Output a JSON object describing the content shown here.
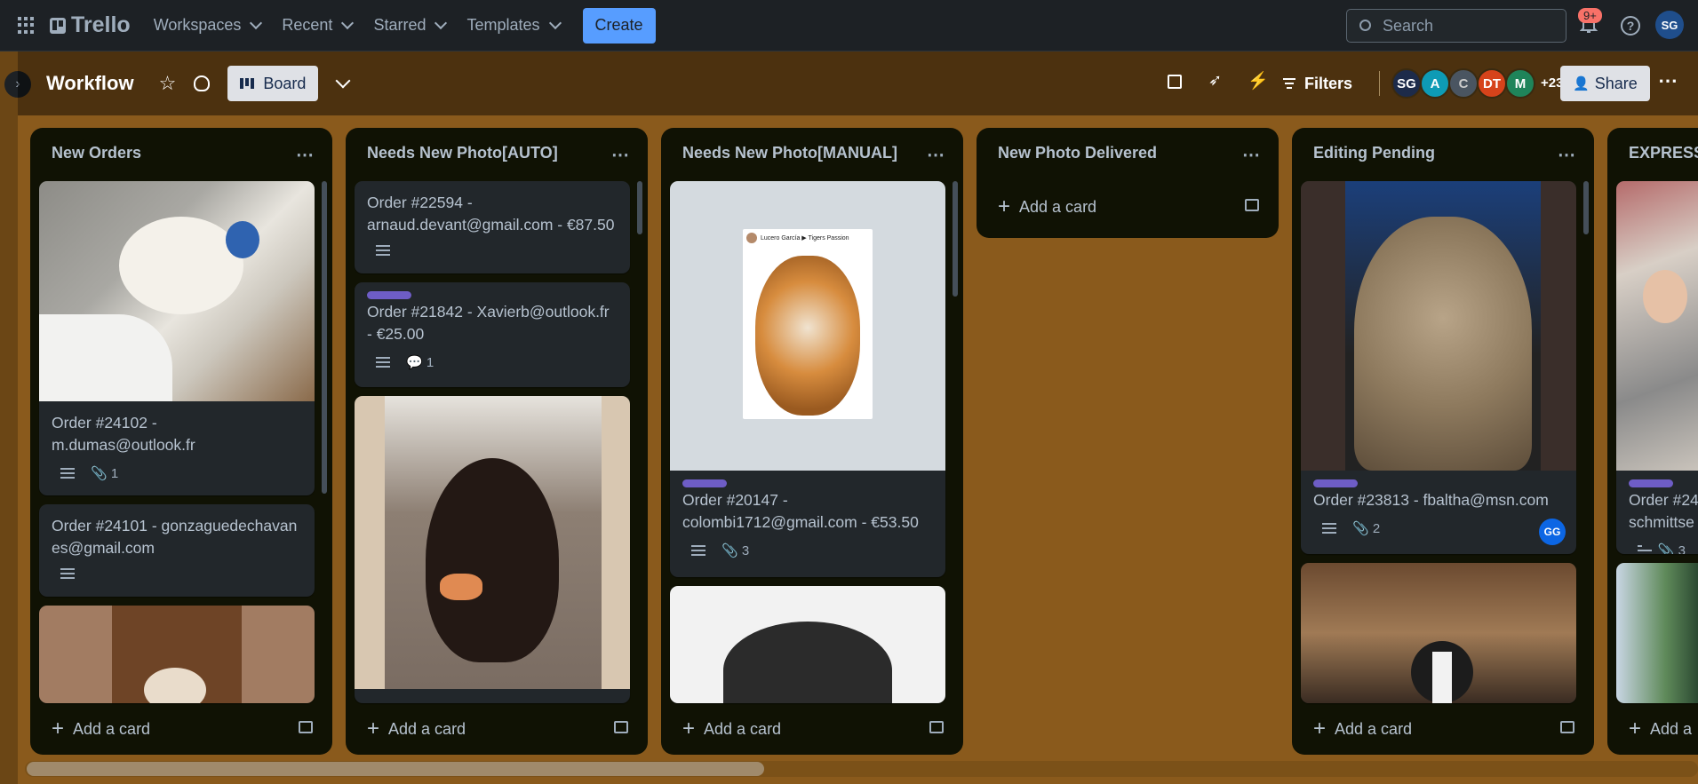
{
  "topbar": {
    "app_name": "Trello",
    "nav": [
      "Workspaces",
      "Recent",
      "Starred",
      "Templates"
    ],
    "create_label": "Create",
    "search_placeholder": "Search",
    "notification_badge": "9+",
    "user_initials": "SG"
  },
  "board": {
    "title": "Workflow",
    "view_label": "Board",
    "filters_label": "Filters",
    "members": [
      "SG",
      "A",
      "C",
      "DT",
      "M"
    ],
    "member_overflow": "+23",
    "share_label": "Share"
  },
  "lists": [
    {
      "title": "New Orders",
      "add_label": "Add a card",
      "cards": [
        {
          "text": "Order #24102 - m.dumas@outlook.fr",
          "attachments": "1"
        },
        {
          "text": "Order #24101 - gonzaguedechavanes@gmail.com"
        }
      ]
    },
    {
      "title": "Needs New Photo[AUTO]",
      "add_label": "Add a card",
      "cards": [
        {
          "text": "Order #22594 - arnaud.devant@gmail.com - €87.50"
        },
        {
          "text": "Order #21842 - Xavierb@outlook.fr - €25.00",
          "comments": "1"
        }
      ]
    },
    {
      "title": "Needs New Photo[MANUAL]",
      "add_label": "Add a card",
      "cards": [
        {
          "text": "Order #20147 - colombi1712@gmail.com - €53.50",
          "attachments": "3",
          "image_caption": "Lucero García ▶ Tigers Passion"
        }
      ]
    },
    {
      "title": "New Photo Delivered",
      "add_label": "Add a card",
      "cards": []
    },
    {
      "title": "Editing Pending",
      "add_label": "Add a card",
      "cards": [
        {
          "text": "Order #23813 - fbaltha@msn.com",
          "attachments": "2",
          "member": "GG"
        }
      ]
    },
    {
      "title": "EXPRESS",
      "add_label": "Add a",
      "cards": [
        {
          "text": "Order #24",
          "text2": "schmittse",
          "attachments": "3"
        }
      ]
    }
  ],
  "colors": {
    "board_bg": "#8a5a1c",
    "list_bg": "#101204",
    "card_bg": "#22272b",
    "accent": "#579dff",
    "label_purple": "#6e5dc6"
  }
}
